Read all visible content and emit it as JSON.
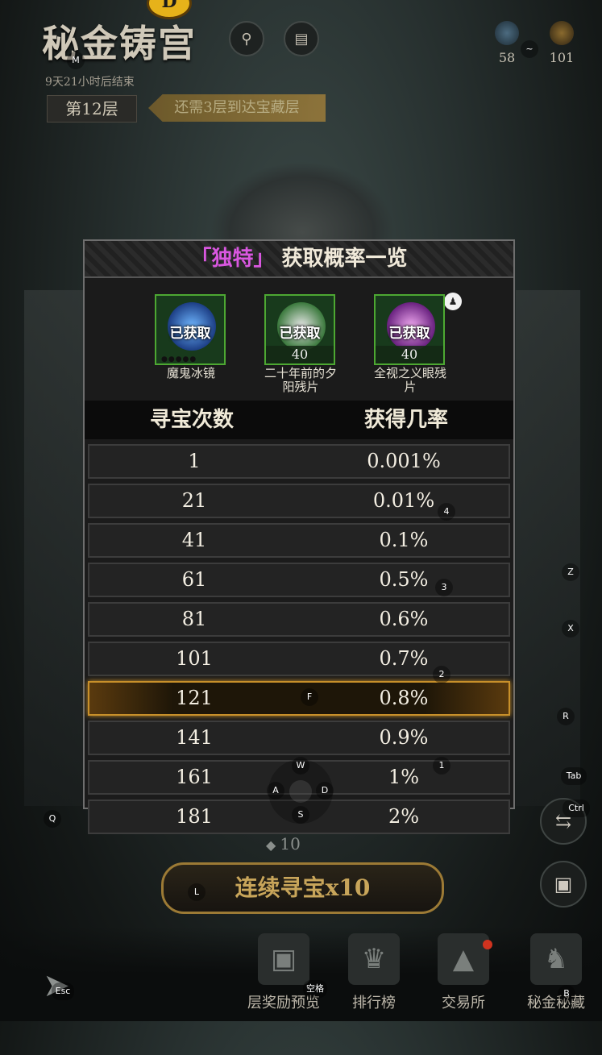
{
  "header": {
    "title": "秘金铸宫",
    "coin_glyph": "D",
    "timer": "9天21小时后结束",
    "floor": "第12层",
    "floor_hint": "还需3层到达宝藏层",
    "resources": [
      {
        "icon": "crystal-icon",
        "value": "58"
      },
      {
        "icon": "compass-icon",
        "value": "101"
      }
    ]
  },
  "modal": {
    "title_open": "「",
    "title_highlight": "独特",
    "title_close": "」",
    "title_rest": "获取概率一览",
    "items": [
      {
        "name": "魔鬼冰镜",
        "status": "已获取",
        "count": "",
        "art_color": "#2a6fd0"
      },
      {
        "name": "二十年前的夕阳残片",
        "status": "已获取",
        "count": "40",
        "art_color": "#c9c9c9"
      },
      {
        "name": "全视之义眼残片",
        "status": "已获取",
        "count": "40",
        "art_color": "#c04ec8"
      }
    ],
    "col_attempts": "寻宝次数",
    "col_rate": "获得几率",
    "rows": [
      {
        "attempts": "1",
        "rate": "0.001%"
      },
      {
        "attempts": "21",
        "rate": "0.01%"
      },
      {
        "attempts": "41",
        "rate": "0.1%"
      },
      {
        "attempts": "61",
        "rate": "0.5%"
      },
      {
        "attempts": "81",
        "rate": "0.6%"
      },
      {
        "attempts": "101",
        "rate": "0.7%"
      },
      {
        "attempts": "121",
        "rate": "0.8%"
      },
      {
        "attempts": "141",
        "rate": "0.9%"
      },
      {
        "attempts": "161",
        "rate": "1%"
      },
      {
        "attempts": "181",
        "rate": "2%"
      }
    ],
    "highlight_attempts": "121"
  },
  "bottom": {
    "count": "10",
    "main_button": "连续寻宝x10",
    "nav": [
      {
        "label": "层奖励预览",
        "icon": "treasure-chest-icon"
      },
      {
        "label": "排行榜",
        "icon": "trophy-icon"
      },
      {
        "label": "交易所",
        "icon": "pyramid-icon"
      },
      {
        "label": "秘金秘藏",
        "icon": "statue-icon"
      }
    ]
  },
  "keys": {
    "m": "M",
    "tilde": "~",
    "four": "4",
    "three": "3",
    "two": "2",
    "one": "1",
    "z": "Z",
    "x": "X",
    "r": "R",
    "f": "F",
    "w": "W",
    "a": "A",
    "s": "S",
    "d": "D",
    "tab": "Tab",
    "ctrl": "Ctrl",
    "q": "Q",
    "l": "L",
    "esc": "Esc",
    "space": "空格",
    "b": "B"
  }
}
